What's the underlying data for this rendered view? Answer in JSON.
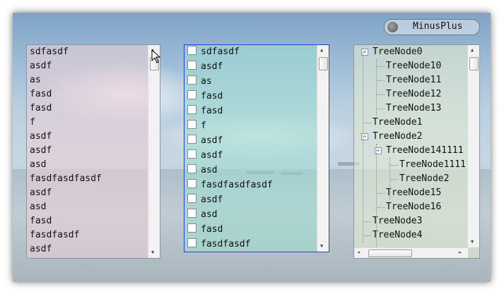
{
  "toggle": {
    "label": "MinusPlus"
  },
  "list1": {
    "items": [
      "sdfasdf",
      "asdf",
      "as",
      "fasd",
      "fasd",
      "f",
      "asdf",
      "asdf",
      "asd",
      "fasdfasdfasdf",
      "asdf",
      "asd",
      "fasd",
      "fasdfasdf",
      "asdf"
    ]
  },
  "list2": {
    "items": [
      "sdfasdf",
      "asdf",
      "as",
      "fasd",
      "fasd",
      "f",
      "asdf",
      "asdf",
      "asd",
      "fasdfasdfasdf",
      "asdf",
      "asd",
      "fasd",
      "fasdfasdf"
    ]
  },
  "tree": {
    "nodes": [
      {
        "label": "TreeNode0",
        "level": 0,
        "expander": "+"
      },
      {
        "label": "TreeNode10",
        "level": 1
      },
      {
        "label": "TreeNode11",
        "level": 1
      },
      {
        "label": "TreeNode12",
        "level": 1
      },
      {
        "label": "TreeNode13",
        "level": 1
      },
      {
        "label": "TreeNode1",
        "level": 0
      },
      {
        "label": "TreeNode2",
        "level": 0,
        "expander": "+"
      },
      {
        "label": "TreeNode141111",
        "level": 1,
        "expander": "+"
      },
      {
        "label": "TreeNode1111",
        "level": 2
      },
      {
        "label": "TreeNode2",
        "level": 2
      },
      {
        "label": "TreeNode15",
        "level": 1
      },
      {
        "label": "TreeNode16",
        "level": 1
      },
      {
        "label": "TreeNode3",
        "level": 0
      },
      {
        "label": "TreeNode4",
        "level": 0
      }
    ]
  },
  "scroll": {
    "up": "▲",
    "down": "▼",
    "left": "◄",
    "right": "►"
  }
}
